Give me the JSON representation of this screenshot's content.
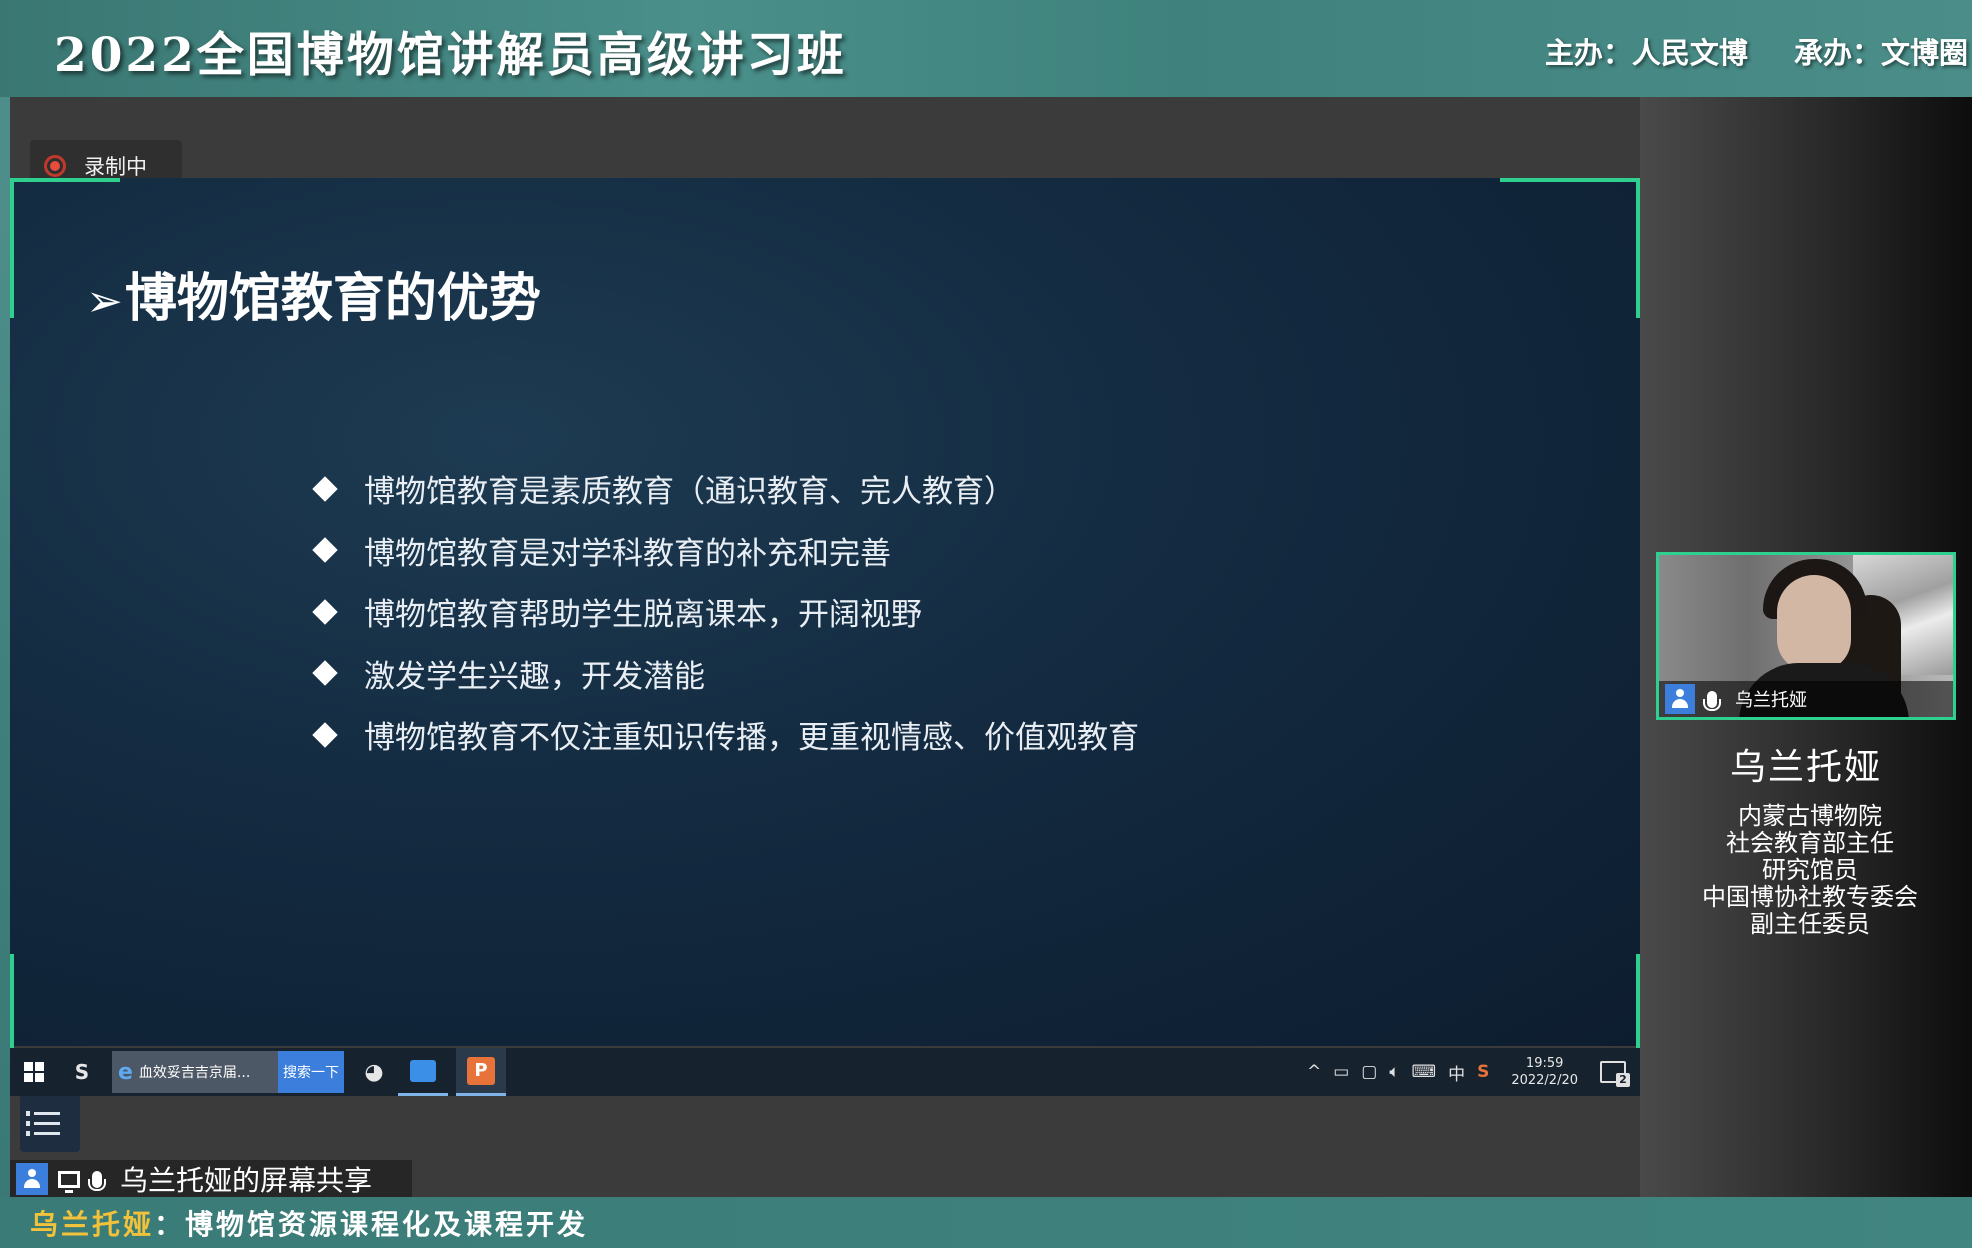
{
  "banner": {
    "title": "2022全国博物馆讲解员高级讲习班",
    "organizer": "主办：人民文博",
    "co_organizer": "承办：文博圈"
  },
  "recording": {
    "label": "录制中"
  },
  "slide": {
    "title": "博物馆教育的优势",
    "bullets": [
      "博物馆教育是素质教育（通识教育、完人教育）",
      "博物馆教育是对学科教育的补充和完善",
      "博物馆教育帮助学生脱离课本，开阔视野",
      "激发学生兴趣，开发潜能",
      "博物馆教育不仅注重知识传播，更重视情感、价值观教育"
    ]
  },
  "taskbar": {
    "ie_tab_label": "血效妥吉吉京届...",
    "search_label": "搜索一下",
    "tray_ime": "中",
    "time": "19:59",
    "date": "2022/2/20",
    "notification_count": "2"
  },
  "share": {
    "label": "乌兰托娅的屏幕共享"
  },
  "video": {
    "name": "乌兰托娅"
  },
  "speaker": {
    "name": "乌兰托娅",
    "info": [
      "内蒙古博物院",
      "社会教育部主任",
      "研究馆员",
      "中国博协社教专委会",
      "副主任委员"
    ]
  },
  "caption": {
    "name": "乌兰托娅",
    "separator": "：",
    "topic": "博物馆资源课程化及课程开发"
  },
  "colors": {
    "accent_green": "#2fcf8f",
    "banner_teal": "#4a8f8a",
    "caption_name": "#f2c23a",
    "rec_red": "#e74c3c"
  }
}
